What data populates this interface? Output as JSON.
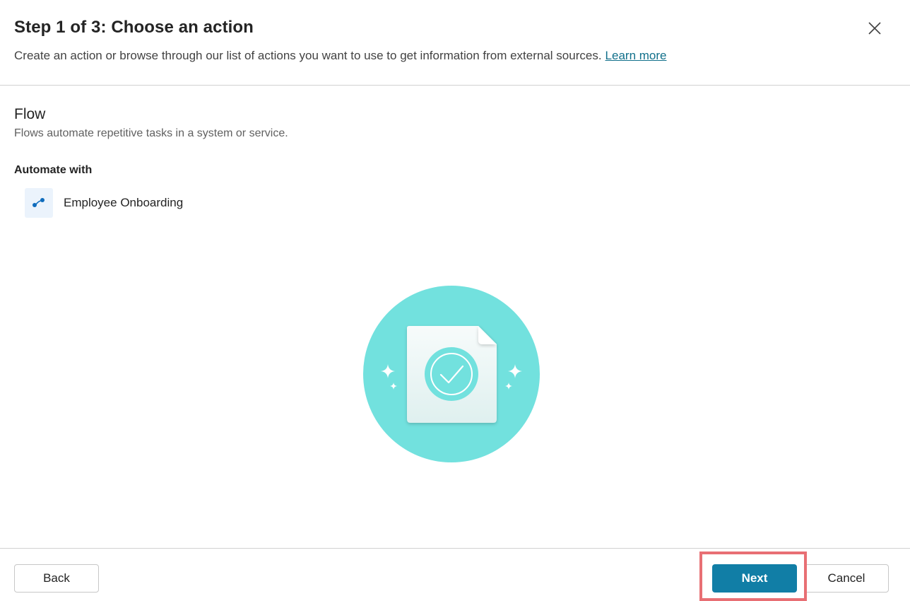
{
  "header": {
    "title": "Step 1 of 3: Choose an action",
    "subtitle": "Create an action or browse through our list of actions you want to use to get information from external sources.",
    "learn_more": "Learn more",
    "close_icon": "close-icon"
  },
  "section": {
    "title": "Flow",
    "description": "Flows automate repetitive tasks in a system or service.",
    "automate_label": "Automate with",
    "flow": {
      "label": "Employee Onboarding",
      "icon": "flow-icon"
    }
  },
  "illustration": {
    "icon": "document-check-illustration"
  },
  "footer": {
    "back_label": "Back",
    "next_label": "Next",
    "cancel_label": "Cancel"
  },
  "colors": {
    "accent": "#117ea6",
    "link": "#11708b",
    "illustration_circle": "#72e1de",
    "highlight": "#e86f74"
  }
}
